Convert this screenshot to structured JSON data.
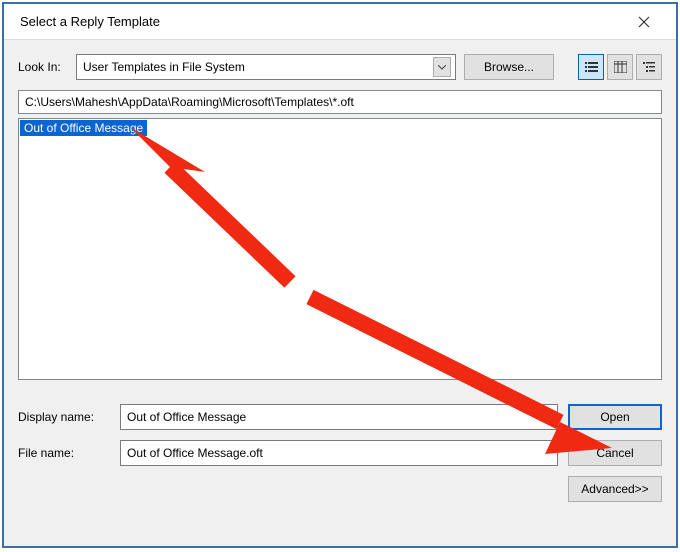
{
  "title": "Select a Reply Template",
  "lookin": {
    "label": "Look In:",
    "value": "User Templates in File System"
  },
  "browse_label": "Browse...",
  "path": "C:\\Users\\Mahesh\\AppData\\Roaming\\Microsoft\\Templates\\*.oft",
  "file_list": {
    "selected_item": "Out of Office Message"
  },
  "display_name": {
    "label": "Display name:",
    "value": "Out of Office Message"
  },
  "file_name": {
    "label": "File name:",
    "value": "Out of Office Message.oft"
  },
  "buttons": {
    "open": "Open",
    "cancel": "Cancel",
    "advanced": "Advanced>>"
  }
}
